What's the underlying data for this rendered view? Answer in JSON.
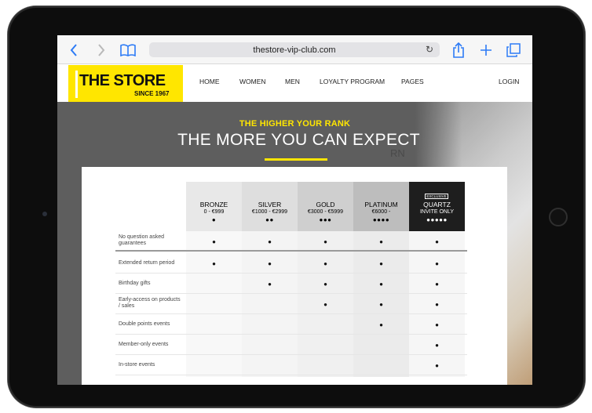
{
  "browser": {
    "url": "thestore-vip-club.com",
    "back_icon": "chevron-left-icon",
    "forward_icon": "chevron-right-icon",
    "bookmarks_icon": "book-icon",
    "share_icon": "share-icon",
    "new_tab_icon": "plus-icon",
    "tabs_icon": "tabs-icon",
    "reload_icon": "reload-icon"
  },
  "site": {
    "logo_main": "THE STORE",
    "logo_sub": "SINCE 1967",
    "nav": [
      "HOME",
      "WOMEN",
      "MEN",
      "LOYALTY PROGRAM",
      "PAGES"
    ],
    "login": "LOGIN",
    "accent_color": "#ffe600"
  },
  "hero": {
    "subtitle": "THE HIGHER YOUR RANK",
    "title": "THE MORE YOU CAN EXPECT",
    "background_fragment": "RN"
  },
  "tiers": [
    {
      "name": "BRONZE",
      "range": "0 - €999",
      "dots": "●"
    },
    {
      "name": "SILVER",
      "range": "€1000 - €2999",
      "dots": "●●"
    },
    {
      "name": "GOLD",
      "range": "€3000 - €5999",
      "dots": "●●●"
    },
    {
      "name": "PLATINUM",
      "range": "€6000 -",
      "dots": "●●●●"
    },
    {
      "name": "QUARTZ",
      "range": "INVITE ONLY",
      "dots": "●●●●●",
      "badge": "EXCLUSIVE"
    }
  ],
  "features": [
    {
      "label": "No question asked guarantees",
      "marks": [
        "●",
        "●",
        "●",
        "●",
        "●"
      ]
    },
    {
      "label": "Extended return period",
      "marks": [
        "●",
        "●",
        "●",
        "●",
        "●"
      ]
    },
    {
      "label": "Birthday gifts",
      "marks": [
        "",
        "●",
        "●",
        "●",
        "●"
      ]
    },
    {
      "label": "Early-access on products / sales",
      "marks": [
        "",
        "",
        "●",
        "●",
        "●"
      ]
    },
    {
      "label": "Double points events",
      "marks": [
        "",
        "",
        "",
        "●",
        "●"
      ]
    },
    {
      "label": "Member-only events",
      "marks": [
        "",
        "",
        "",
        "",
        "●"
      ]
    },
    {
      "label": "In-store events",
      "marks": [
        "",
        "",
        "",
        "",
        "●"
      ]
    }
  ]
}
